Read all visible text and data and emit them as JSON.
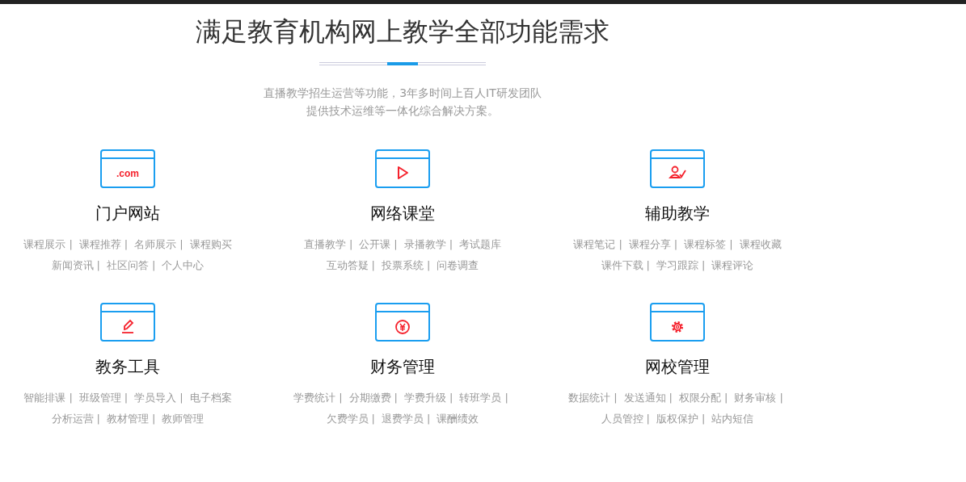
{
  "title": "满足教育机构网上教学全部功能需求",
  "subtitle_lines": [
    "直播教学招生运营等功能，3年多时间上百人IT研发团队",
    "提供技术运维等一体化综合解决方案。"
  ],
  "features": [
    {
      "kind": "domain",
      "icon_text": ".com",
      "name": "门户网站",
      "lines": [
        [
          "课程展示",
          "|",
          "课程推荐",
          "|",
          "名师展示",
          "|",
          "课程购买"
        ],
        [
          "新闻资讯",
          "|",
          "社区问答",
          "|",
          "个人中心"
        ]
      ]
    },
    {
      "kind": "play",
      "name": "网络课堂",
      "lines": [
        [
          "直播教学",
          "|",
          "公开课",
          "|",
          "录播教学",
          "|",
          "考试题库"
        ],
        [
          "互动答疑",
          "|",
          "投票系统",
          "|",
          "问卷调查"
        ]
      ]
    },
    {
      "kind": "user-check",
      "name": "辅助教学",
      "lines": [
        [
          "课程笔记",
          "|",
          "课程分享",
          "|",
          "课程标签",
          "|",
          "课程收藏"
        ],
        [
          "课件下载",
          "|",
          "学习跟踪",
          "|",
          "课程评论"
        ]
      ]
    },
    {
      "kind": "pencil",
      "name": "教务工具",
      "lines": [
        [
          "智能排课",
          "|",
          "班级管理",
          "|",
          "学员导入",
          "|",
          "电子档案"
        ],
        [
          "分析运营",
          "|",
          "教材管理",
          "|",
          "教师管理"
        ]
      ]
    },
    {
      "kind": "yen",
      "name": "财务管理",
      "lines": [
        [
          "学费统计",
          "|",
          "分期缴费",
          "|",
          "学费升级",
          "|",
          "转班学员",
          "|"
        ],
        [
          "欠费学员",
          "|",
          "退费学员",
          "|",
          "课酬绩效"
        ]
      ]
    },
    {
      "kind": "gear",
      "name": "网校管理",
      "lines": [
        [
          "数据统计",
          "|",
          "发送通知",
          "|",
          "权限分配",
          "|",
          "财务审核",
          "|"
        ],
        [
          "人员管控",
          "|",
          "版权保护",
          "|",
          "站内短信"
        ]
      ]
    }
  ]
}
